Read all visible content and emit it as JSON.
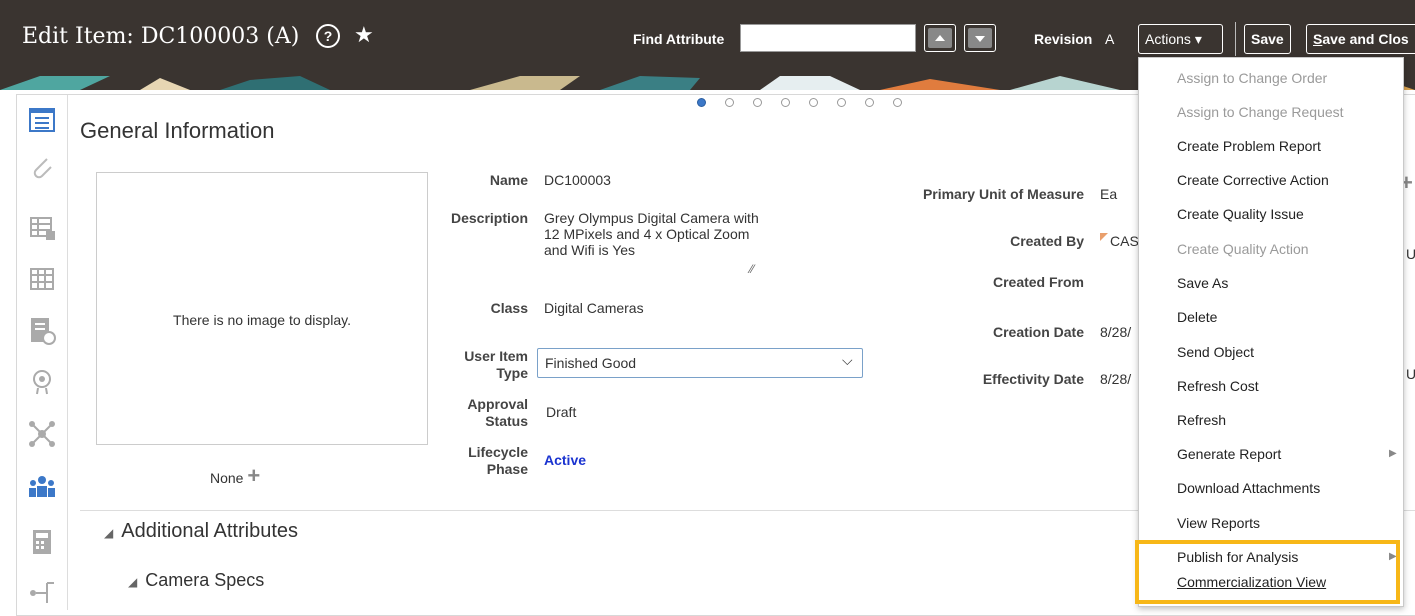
{
  "header": {
    "title": "Edit Item: DC100003 (A)",
    "find_attribute_label": "Find Attribute",
    "find_attribute_value": "",
    "revision_label": "Revision",
    "revision_value": "A",
    "actions_label": "Actions",
    "save_label": "Save",
    "save_close_label": "Save and Clos"
  },
  "carousel": {
    "count": 8,
    "active_index": 0
  },
  "section": {
    "title": "General Information"
  },
  "image": {
    "placeholder": "There is no image to display.",
    "none_label": "None"
  },
  "fields": {
    "name_label": "Name",
    "name_value": "DC100003",
    "description_label": "Description",
    "description_value": "Grey Olympus Digital Camera with 12 MPixels and 4 x Optical Zoom and Wifi is Yes",
    "class_label": "Class",
    "class_value": "Digital Cameras",
    "user_item_type_label_1": "User Item",
    "user_item_type_label_2": "Type",
    "user_item_type_value": "Finished Good",
    "approval_status_label_1": "Approval",
    "approval_status_label_2": "Status",
    "approval_status_value": "Draft",
    "lifecycle_phase_label_1": "Lifecycle",
    "lifecycle_phase_label_2": "Phase",
    "lifecycle_phase_value": "Active",
    "primary_uom_label": "Primary Unit of Measure",
    "primary_uom_value": "Ea",
    "created_by_label": "Created By",
    "created_by_value": "CAS",
    "created_from_label": "Created From",
    "creation_date_label": "Creation Date",
    "creation_date_value": "8/28/",
    "effectivity_date_label": "Effectivity Date",
    "effectivity_date_value": "8/28/"
  },
  "additional": {
    "title": "Additional Attributes",
    "camera_specs": "Camera Specs"
  },
  "actions_menu": {
    "items": [
      {
        "label": "Assign to Change Order",
        "disabled": true
      },
      {
        "label": "Assign to Change Request",
        "disabled": true
      },
      {
        "label": "Create Problem Report",
        "disabled": false
      },
      {
        "label": "Create Corrective Action",
        "disabled": false
      },
      {
        "label": "Create Quality Issue",
        "disabled": false
      },
      {
        "label": "Create Quality Action",
        "disabled": true
      },
      {
        "label": "Save As",
        "disabled": false
      },
      {
        "label": "Delete",
        "disabled": false
      },
      {
        "label": "Send Object",
        "disabled": false
      },
      {
        "label": "Refresh Cost",
        "disabled": false
      },
      {
        "label": "Refresh",
        "disabled": false
      },
      {
        "label": "Generate Report",
        "disabled": false,
        "submenu": true
      },
      {
        "label": "Download Attachments",
        "disabled": false
      },
      {
        "label": "View Reports",
        "disabled": false
      },
      {
        "label": "Publish for Analysis",
        "disabled": false,
        "submenu": true
      },
      {
        "label": "Commercialization View",
        "disabled": false,
        "underlined": true
      }
    ]
  },
  "right_edge": {
    "u1": "U",
    "u2": "U"
  },
  "colors": {
    "header_bg": "#3a3430",
    "highlight": "#f7b718",
    "link_blue": "#1a33d0"
  }
}
